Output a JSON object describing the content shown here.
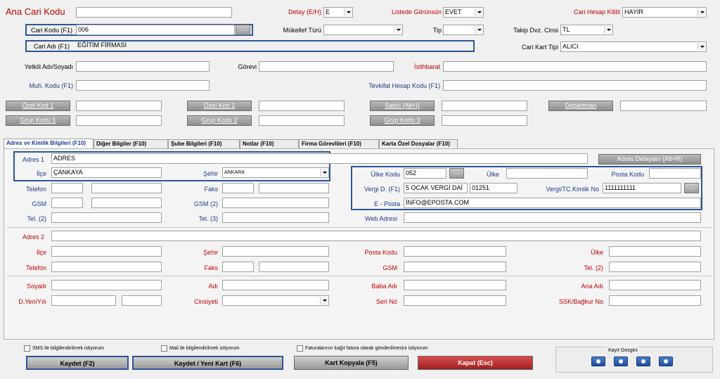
{
  "top": {
    "ana_cari_kodu_label": "Ana Cari Kodu",
    "detay_label": "Detay (E/H)",
    "detay_value": "E",
    "listede_label": "Listede Görünsün",
    "listede_value": "EVET",
    "kilitli_label": "Cari Hesap Kilitli",
    "kilitli_value": "HAYIR",
    "cari_kodu_label": "Cari Kodu (F1)",
    "cari_kodu_value": "006",
    "mukellef_label": "Mükellef Türü",
    "tip_label": "Tip",
    "takip_label": "Takip Dvz. Cinsi",
    "takip_value": "TL",
    "cari_adi_label": "Cari Adı (F1)",
    "cari_adi_value": "EĞİTİM FİRMASI",
    "kart_tipi_label": "Cari Kart Tipi",
    "kart_tipi_value": "ALICI",
    "yetkili_label": "Yetkili Adı/Soyadı",
    "gorevi_label": "Görevi",
    "istihbarat_label": "İstihbarat",
    "muh_kodu_label": "Muh. Kodu (F1)",
    "tevkifat_label": "Tevkifat Hesap Kodu (F1)",
    "ozel_kod_1": "Özel Kod 1",
    "ozel_kod_2": "Özel Kod 2",
    "satici": "Satıcı (Alt+I)",
    "departman": "Departman",
    "grup_kodu_1": "Grup Kodu 1",
    "grup_kodu_2": "Grup Kodu 2",
    "grup_kodu_3": "Grup Kodu 3",
    "dots": "..."
  },
  "tabs": [
    "Adres ve Kimlik Bilgileri (F10)",
    "Diğer Bilgiler (F10)",
    "Şube Bilgileri (F10)",
    "Notlar (F10)",
    "Firma Görevlileri  (F10)",
    "Karta Özel Dosyalar (F10)"
  ],
  "address": {
    "adres1_label": "Adres 1",
    "adres1_value": "ADRES",
    "adres_detay_button": "Adres Detayları (Alt+R)",
    "ilce_label": "İlçe",
    "ilce_value": "ÇANKAYA",
    "sehir_label": "Şehir",
    "sehir_value": "ANKARA",
    "ulke_kodu_label": "Ülke Kodu",
    "ulke_kodu_value": "052",
    "ulke_label": "Ülke",
    "posta_kodu_label": "Posta Kodu",
    "telefon_label": "Telefon",
    "faks_label": "Faks",
    "vergi_d_label": "Vergi D. (F1)",
    "vergi_d_value": "5 OCAK VERGİ DAİ",
    "vergi_d_code": "01251",
    "vergi_no_label": "Vergi/TC.Kimlik No",
    "vergi_no_value": "1111111111",
    "gsm_label": "GSM",
    "gsm2_label": "GSM (2)",
    "eposta_label": "E - Posta",
    "eposta_value": "İNFO@EPOSTA.COM",
    "tel2_label": "Tel. (2)",
    "tel3_label": "Tel. (3)",
    "web_label": "Web Adresi"
  },
  "address2": {
    "adres2_label": "Adres 2",
    "ilce_label": "İlçe",
    "sehir_label": "Şehir",
    "posta_kodu_label": "Posta Kodu",
    "ulke_label": "Ülke",
    "telefon_label": "Telefon",
    "faks_label": "Faks",
    "gsm_label": "GSM",
    "tel2_label": "Tel. (2)"
  },
  "identity": {
    "soyadi_label": "Soyadı",
    "adi_label": "Adı",
    "baba_adi_label": "Baba Adı",
    "ana_adi_label": "Ana Adı",
    "dyeri_label": "D.Yeri/Yılı",
    "cinsiyeti_label": "Cinsiyeti",
    "seri_no_label": "Seri No",
    "ssk_label": "SSK/Bağkur No"
  },
  "footer": {
    "sms_label": "SMS ile bilgilendirilmek istiyorum",
    "mail_label": "Mail ile bilgilendirilmek istiyorum",
    "fatura_label": "Faturalarının kağıt fatura olarak gönderilmesini istiyorum",
    "kaydet": "Kaydet (F2)",
    "kaydet_yeni": "Kaydet / Yeni Kart (F6)",
    "kopyala": "Kart Kopyala (F5)",
    "kapat": "Kapat (Esc)",
    "kayit_gezgini": "Kayıt Gezgini"
  }
}
